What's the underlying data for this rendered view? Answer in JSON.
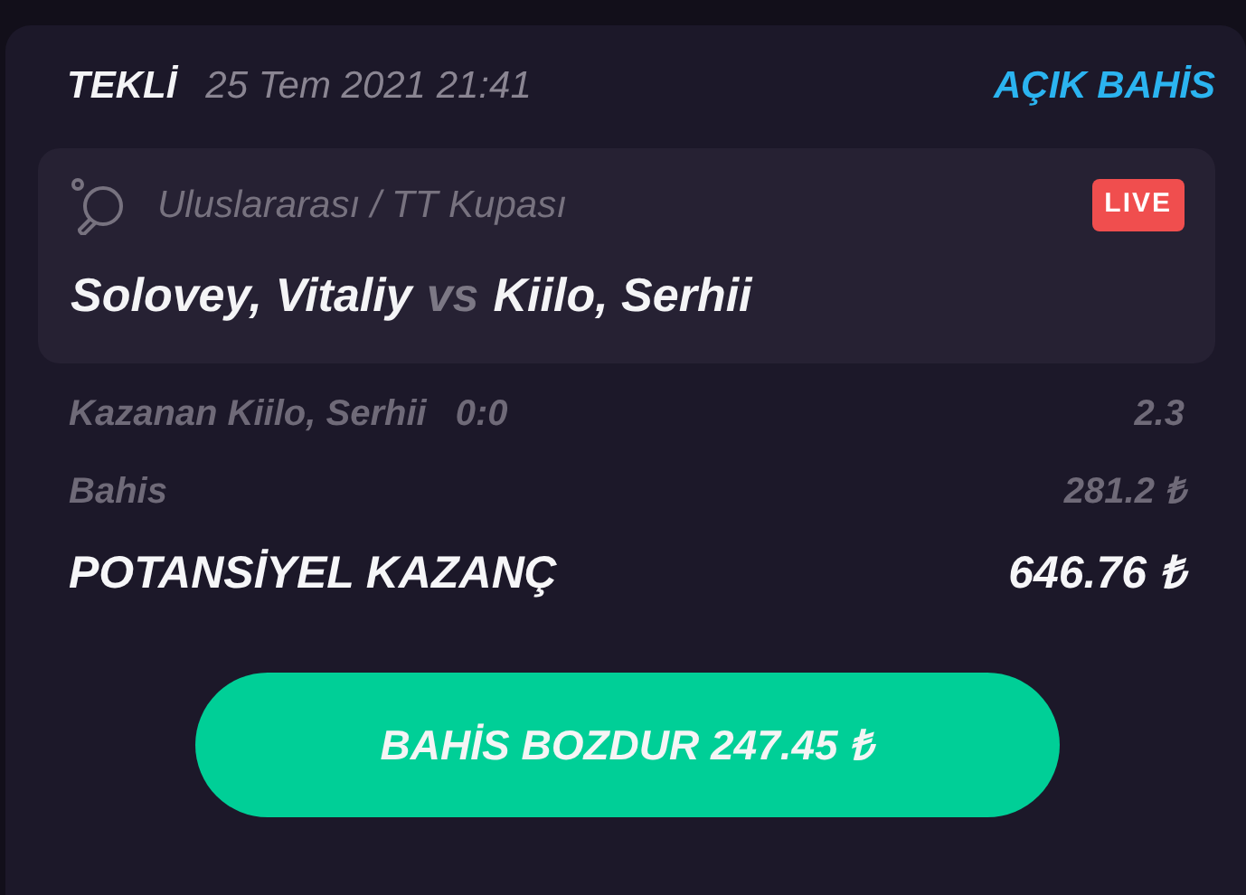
{
  "header": {
    "type": "TEKLİ",
    "datetime": "25 Tem 2021 21:41",
    "status": "AÇIK BAHİS"
  },
  "event": {
    "league": "Uluslararası / TT Kupası",
    "live_badge": "LIVE",
    "home": "Solovey, Vitaliy",
    "separator": "vs",
    "away": "Kiilo, Serhii"
  },
  "rows": [
    {
      "kind": "muted",
      "label": "Kazanan Kiilo, Serhii",
      "score": "0:0",
      "value": "2.3"
    },
    {
      "kind": "muted",
      "label": "Bahis",
      "value": "281.2 ₺"
    },
    {
      "kind": "total",
      "label": "POTANSİYEL KAZANÇ",
      "value": "646.76 ₺"
    }
  ],
  "cashout_button": "BAHİS BOZDUR 247.45 ₺"
}
